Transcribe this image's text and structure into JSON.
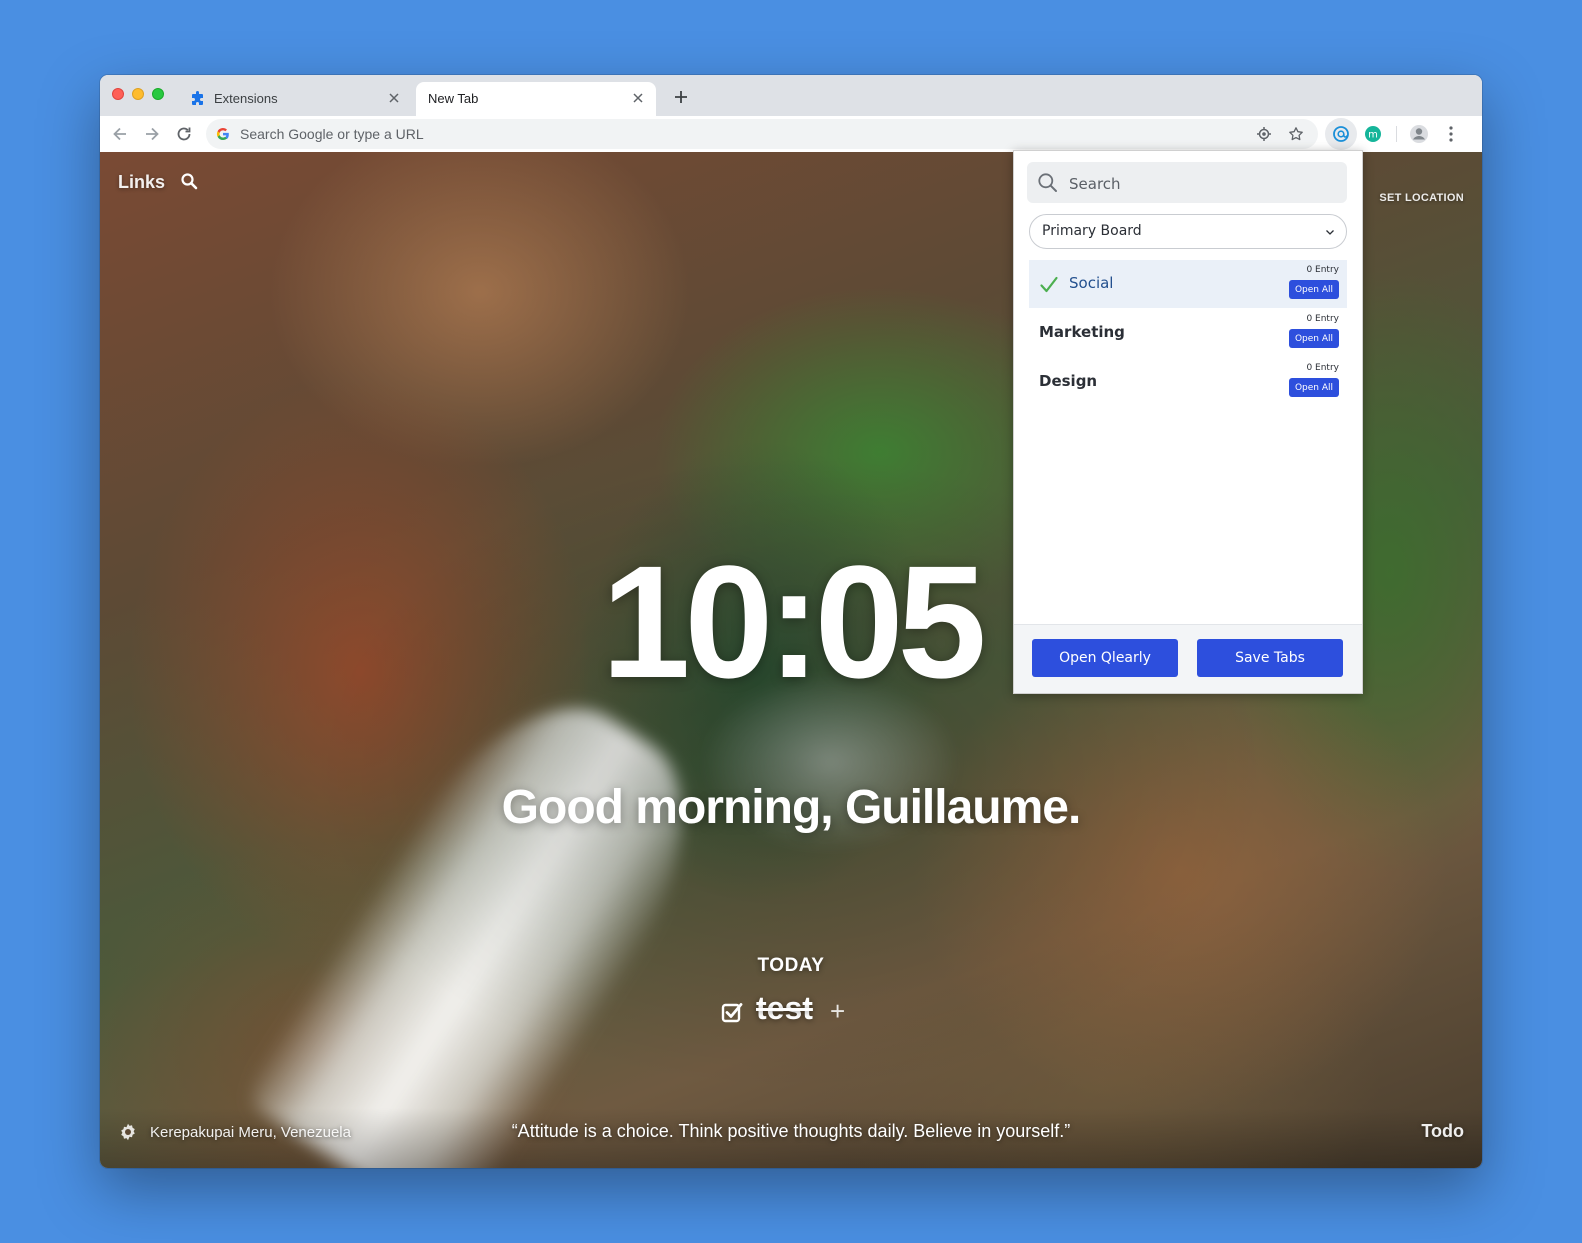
{
  "browser": {
    "tabs": [
      {
        "title": "Extensions",
        "favicon": "puzzle-icon",
        "active": false
      },
      {
        "title": "New Tab",
        "active": true
      }
    ],
    "omnibox": {
      "placeholder": "Search Google or type a URL"
    },
    "toolbar_icons": [
      "back-icon",
      "forward-icon",
      "reload-icon",
      "location-icon",
      "star-icon",
      "qlearly-extension-icon",
      "momentum-extension-icon",
      "profile-avatar-icon",
      "menu-kebab-icon"
    ],
    "extension_badge_letter": "m"
  },
  "dashboard": {
    "links_label": "Links",
    "set_location_label": "SET LOCATION",
    "clock": "10:05",
    "greeting": "Good morning, Guillaume.",
    "today_label": "TODAY",
    "todo": {
      "text": "test",
      "done": true,
      "add_glyph": "+"
    },
    "location": "Kerepakupai Meru, Venezuela",
    "quote": "“Attitude is a choice. Think positive thoughts daily. Believe in yourself.”",
    "todo_label": "Todo"
  },
  "popup": {
    "search_placeholder": "Search",
    "board_selected": "Primary Board",
    "collections": [
      {
        "label": "Social",
        "count": "0 Entry",
        "action": "Open All",
        "selected": true
      },
      {
        "label": "Marketing",
        "count": "0 Entry",
        "action": "Open All",
        "selected": false
      },
      {
        "label": "Design",
        "count": "0 Entry",
        "action": "Open All",
        "selected": false
      }
    ],
    "footer": {
      "open_label": "Open Qlearly",
      "save_label": "Save Tabs"
    }
  },
  "colors": {
    "desktop_background": "#4a8fe2",
    "popup_button": "#2d4fdd",
    "selected_item_text": "#23508e",
    "selected_item_bg": "#eaf0f8",
    "check_green": "#4caf50"
  }
}
